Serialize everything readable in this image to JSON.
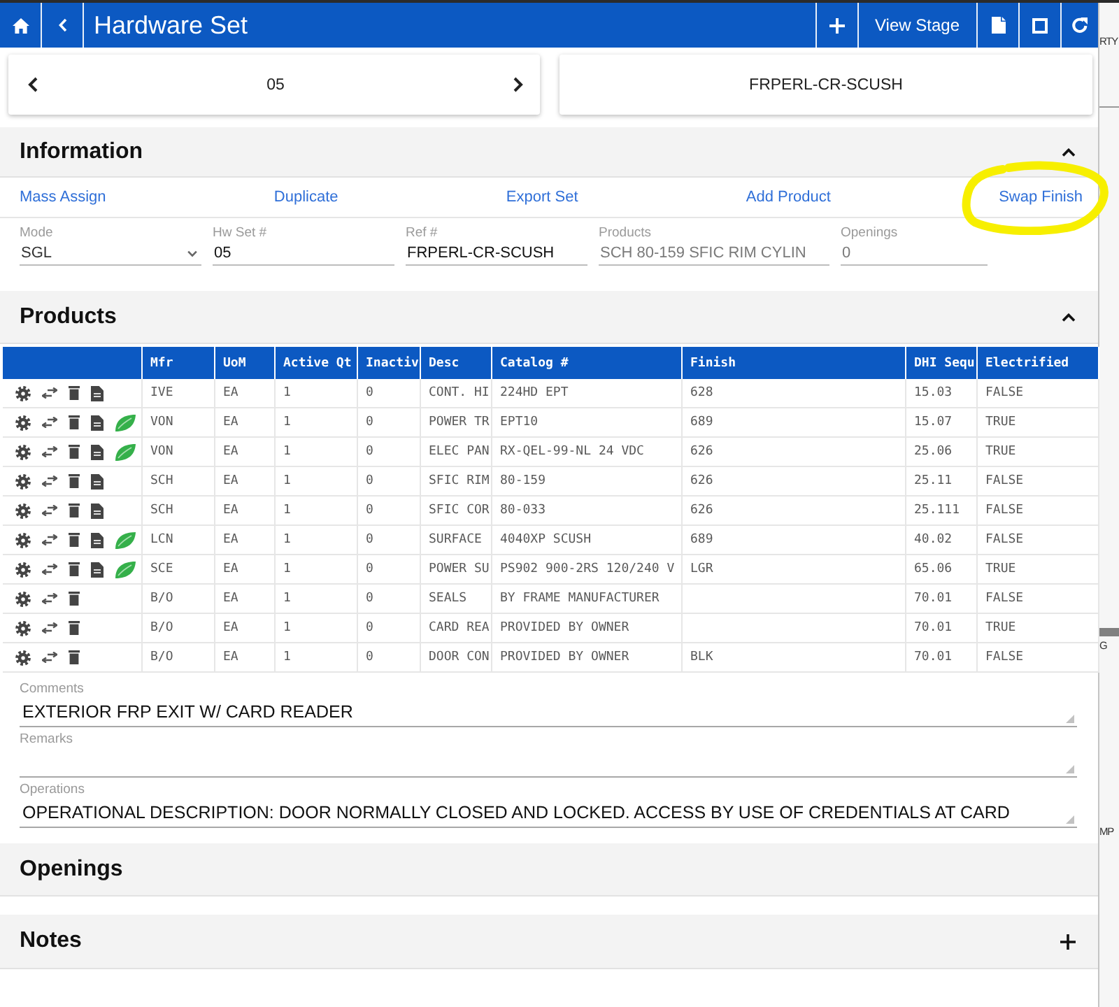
{
  "top_bar": {
    "title": "Hardware Set",
    "stage_button": "View Stage"
  },
  "nav_card": {
    "value": "05"
  },
  "ref_card": {
    "value": "FRPERL-CR-SCUSH"
  },
  "information": {
    "title": "Information",
    "expanded": true,
    "actions": [
      {
        "label": "Mass Assign",
        "highlighted": false
      },
      {
        "label": "Duplicate",
        "highlighted": false
      },
      {
        "label": "Export Set",
        "highlighted": false
      },
      {
        "label": "Add Product",
        "highlighted": false
      },
      {
        "label": "Swap Finish",
        "highlighted": true
      }
    ],
    "fields": [
      {
        "kind": "select",
        "label": "Mode",
        "value": "SGL",
        "disabled": false
      },
      {
        "kind": "input",
        "label": "Hw Set #",
        "value": "05",
        "disabled": false
      },
      {
        "kind": "input",
        "label": "Ref #",
        "value": "FRPERL-CR-SCUSH",
        "disabled": false
      },
      {
        "kind": "input",
        "label": "Products",
        "value": "SCH 80-159 SFIC RIM CYLIN",
        "disabled": true
      },
      {
        "kind": "input",
        "label": "Openings",
        "value": "0",
        "disabled": true
      }
    ]
  },
  "products": {
    "title": "Products",
    "expanded": true,
    "table": {
      "columns": [
        "Mfr",
        "UoM",
        "Active Qt",
        "Inactiv",
        "Desc",
        "Catalog #",
        "Finish",
        "DHI Sequ",
        "Electrified"
      ],
      "rows": [
        {
          "has_document": true,
          "has_leaf": false,
          "mfr": "IVE",
          "uom": "EA",
          "active_qty": "1",
          "inactive_qty": "0",
          "desc": "CONT. HI",
          "catalog": "224HD EPT",
          "finish": "628",
          "dhi_seq": "15.03",
          "electrified": "FALSE"
        },
        {
          "has_document": true,
          "has_leaf": true,
          "mfr": "VON",
          "uom": "EA",
          "active_qty": "1",
          "inactive_qty": "0",
          "desc": "POWER TR",
          "catalog": "EPT10",
          "finish": "689",
          "dhi_seq": "15.07",
          "electrified": "TRUE"
        },
        {
          "has_document": true,
          "has_leaf": true,
          "mfr": "VON",
          "uom": "EA",
          "active_qty": "1",
          "inactive_qty": "0",
          "desc": "ELEC PAN",
          "catalog": "RX-QEL-99-NL 24 VDC",
          "finish": "626",
          "dhi_seq": "25.06",
          "electrified": "TRUE"
        },
        {
          "has_document": true,
          "has_leaf": false,
          "mfr": "SCH",
          "uom": "EA",
          "active_qty": "1",
          "inactive_qty": "0",
          "desc": "SFIC RIM",
          "catalog": "80-159",
          "finish": "626",
          "dhi_seq": "25.11",
          "electrified": "FALSE"
        },
        {
          "has_document": true,
          "has_leaf": false,
          "mfr": "SCH",
          "uom": "EA",
          "active_qty": "1",
          "inactive_qty": "0",
          "desc": "SFIC COR",
          "catalog": "80-033",
          "finish": "626",
          "dhi_seq": "25.111",
          "electrified": "FALSE"
        },
        {
          "has_document": true,
          "has_leaf": true,
          "mfr": "LCN",
          "uom": "EA",
          "active_qty": "1",
          "inactive_qty": "0",
          "desc": "SURFACE",
          "catalog": "4040XP SCUSH",
          "finish": "689",
          "dhi_seq": "40.02",
          "electrified": "FALSE"
        },
        {
          "has_document": true,
          "has_leaf": true,
          "mfr": "SCE",
          "uom": "EA",
          "active_qty": "1",
          "inactive_qty": "0",
          "desc": "POWER SU",
          "catalog": "PS902 900-2RS 120/240 V",
          "finish": "LGR",
          "dhi_seq": "65.06",
          "electrified": "TRUE"
        },
        {
          "has_document": false,
          "has_leaf": false,
          "mfr": "B/O",
          "uom": "EA",
          "active_qty": "1",
          "inactive_qty": "0",
          "desc": "SEALS",
          "catalog": "BY FRAME MANUFACTURER",
          "dhi_seq": "70.01",
          "electrified": "FALSE"
        },
        {
          "has_document": false,
          "has_leaf": false,
          "mfr": "B/O",
          "uom": "EA",
          "active_qty": "1",
          "inactive_qty": "0",
          "desc": "CARD REA",
          "catalog": "PROVIDED BY OWNER",
          "dhi_seq": "70.01",
          "electrified": "TRUE"
        },
        {
          "has_document": false,
          "has_leaf": false,
          "mfr": "B/O",
          "uom": "EA",
          "active_qty": "1",
          "inactive_qty": "0",
          "desc": "DOOR CON",
          "catalog": "PROVIDED BY OWNER",
          "finish": "BLK",
          "dhi_seq": "70.01",
          "electrified": "FALSE"
        }
      ]
    }
  },
  "text_areas": [
    {
      "label": "Comments",
      "value": "EXTERIOR FRP EXIT W/ CARD READER"
    },
    {
      "label": "Remarks"
    },
    {
      "label": "Operations",
      "value": "OPERATIONAL DESCRIPTION: DOOR NORMALLY CLOSED AND LOCKED. ACCESS BY USE OF CREDENTIALS AT CARD"
    }
  ],
  "sections": [
    {
      "title": "Openings",
      "kind": "plain"
    },
    {
      "title": "Notes",
      "kind": "add"
    }
  ],
  "background_window": {
    "texts": [
      "RTY",
      "G",
      "MP"
    ]
  }
}
